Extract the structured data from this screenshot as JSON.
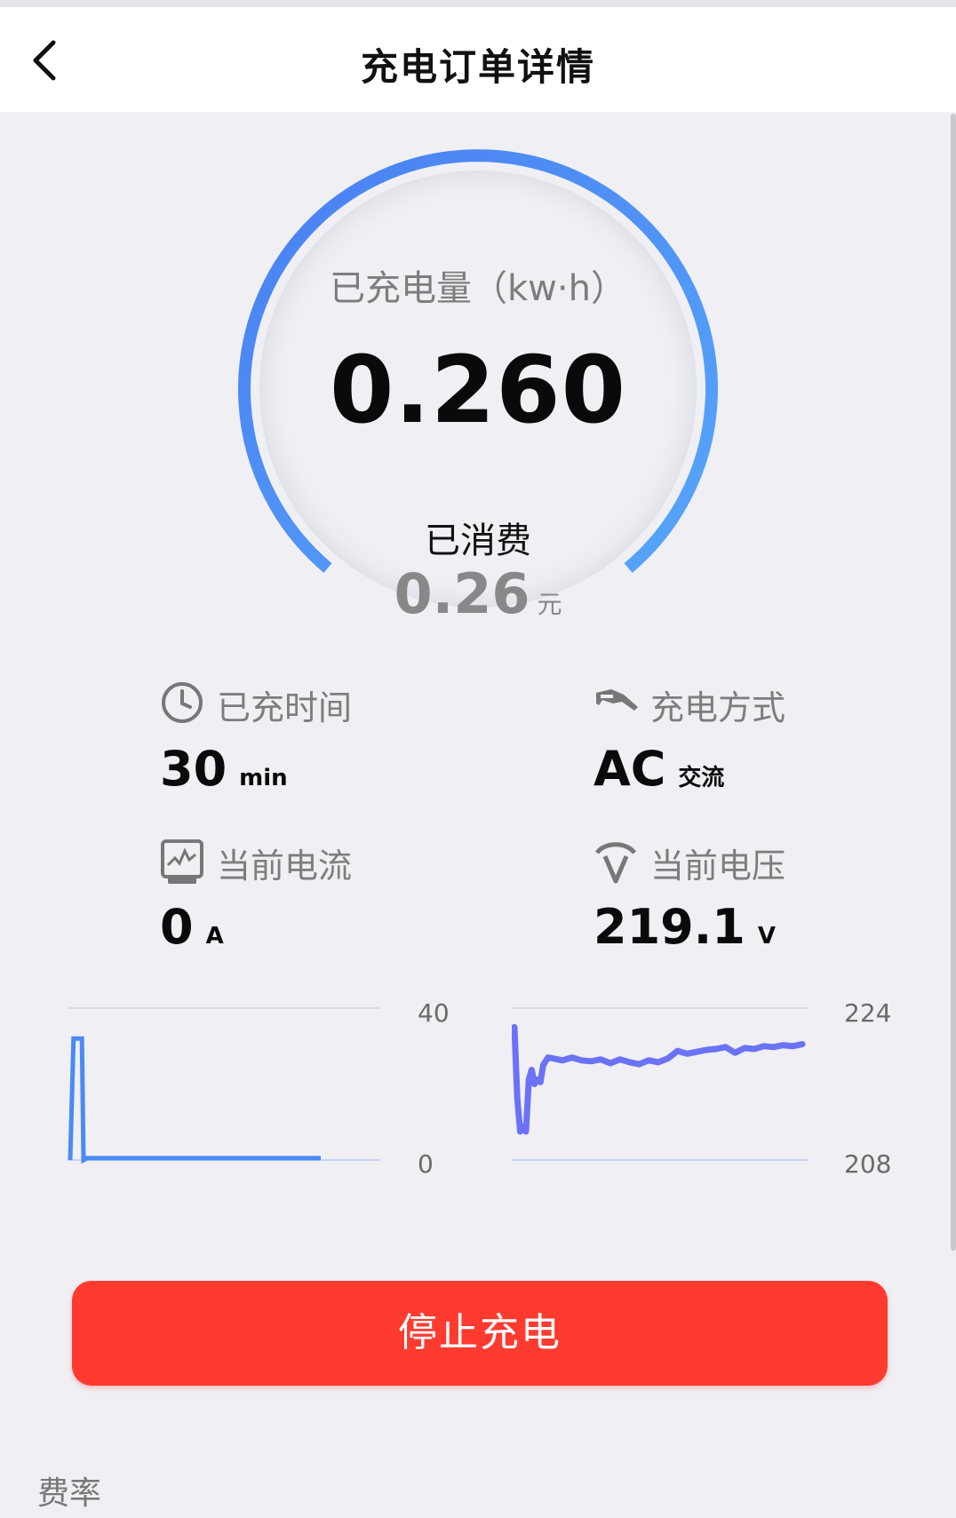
{
  "header": {
    "title": "充电订单详情",
    "back_icon": "chevron-left-icon"
  },
  "gauge": {
    "label": "已充电量（kw·h）",
    "value": "0.260",
    "spent_label": "已消费",
    "spent_value": "0.26",
    "spent_unit": "元",
    "colors": {
      "start": "#4a8af4",
      "end": "#5aa4f8"
    }
  },
  "stats": {
    "charge_time": {
      "icon": "clock-icon",
      "label": "已充时间",
      "value": "30",
      "unit": "min"
    },
    "charge_mode": {
      "icon": "charging-plug-icon",
      "label": "充电方式",
      "value": "AC",
      "unit": "交流"
    },
    "current": {
      "icon": "current-meter-icon",
      "label": "当前电流",
      "value": "0",
      "unit": "A"
    },
    "voltage": {
      "icon": "voltage-icon",
      "label": "当前电压",
      "value": "219.1",
      "unit": "V"
    }
  },
  "chart_data": [
    {
      "type": "line",
      "y_top_label": "40",
      "y_bottom_label": "0",
      "ylim": [
        0,
        40
      ],
      "x": [
        0,
        0.4,
        1,
        1.4,
        1.6,
        2,
        3,
        5,
        8,
        12,
        16,
        20,
        24,
        28,
        30
      ],
      "values": [
        0,
        32,
        32,
        32,
        0,
        0.5,
        0.5,
        0.5,
        0.5,
        0.5,
        0.5,
        0.5,
        0.5,
        0.5,
        0.5
      ],
      "color": "#4a8af4"
    },
    {
      "type": "line",
      "y_top_label": "224",
      "y_bottom_label": "208",
      "ylim": [
        208,
        224
      ],
      "x": [
        0,
        0.3,
        0.6,
        0.9,
        1.2,
        1.5,
        1.8,
        2.1,
        2.4,
        2.7,
        3,
        3.5,
        4,
        5,
        6,
        7,
        8,
        9,
        10,
        11,
        12,
        13,
        14,
        15,
        16,
        17,
        18,
        19,
        20,
        21,
        22,
        23,
        24,
        25,
        26,
        27,
        28,
        29,
        30
      ],
      "values": [
        222,
        214.5,
        211,
        211.5,
        211,
        216.5,
        217.5,
        216,
        216.5,
        216.2,
        218,
        218.8,
        218.7,
        218.5,
        218.8,
        218.5,
        218.4,
        218.6,
        218.2,
        218.6,
        218.3,
        218.1,
        218.5,
        218.3,
        218.7,
        219.5,
        219.2,
        219.4,
        219.6,
        219.7,
        219.9,
        219.3,
        219.8,
        219.7,
        220.0,
        219.9,
        220.1,
        220.0,
        220.2
      ],
      "color": "#6b72f5"
    }
  ],
  "actions": {
    "stop_label": "停止充电",
    "stop_color": "#ff3b30"
  },
  "sections": {
    "rate_title": "费率"
  }
}
